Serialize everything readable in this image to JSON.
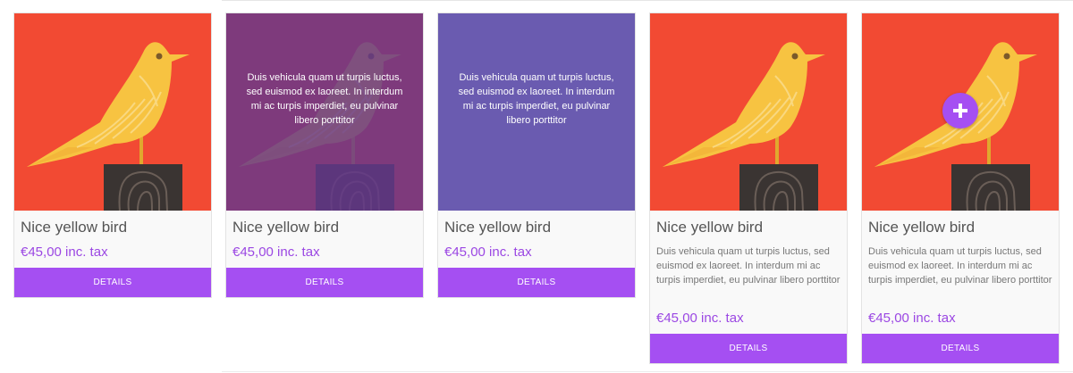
{
  "colors": {
    "image_bg": "#f24a33",
    "bird": "#f7c341",
    "stump": "#3a3432",
    "accent": "#a54ff2",
    "overlay_semi": "#64378c",
    "overlay_solid": "#6a5bb0"
  },
  "cards": [
    {
      "title": "Nice yellow bird",
      "price": "€45,00 inc. tax",
      "button": "DETAILS"
    },
    {
      "title": "Nice yellow bird",
      "price": "€45,00 inc. tax",
      "button": "DETAILS",
      "overlay_text": "Duis vehicula quam ut turpis luctus, sed euismod ex laoreet. In interdum mi ac turpis imperdiet, eu pulvinar libero porttitor"
    },
    {
      "title": "Nice yellow bird",
      "price": "€45,00 inc. tax",
      "button": "DETAILS",
      "overlay_text": "Duis vehicula quam ut turpis luctus, sed euismod ex laoreet. In interdum mi ac turpis imperdiet, eu pulvinar libero porttitor"
    },
    {
      "title": "Nice yellow bird",
      "price": "€45,00 inc. tax",
      "button": "DETAILS",
      "description": "Duis vehicula quam ut turpis luctus, sed euismod ex laoreet. In interdum mi ac turpis imperdiet, eu pulvinar libero porttitor"
    },
    {
      "title": "Nice yellow bird",
      "price": "€45,00 inc. tax",
      "button": "DETAILS",
      "description": "Duis vehicula quam ut turpis luctus, sed euismod ex laoreet. In interdum mi ac turpis imperdiet, eu pulvinar libero porttitor",
      "action_icon": "plus-icon"
    }
  ]
}
